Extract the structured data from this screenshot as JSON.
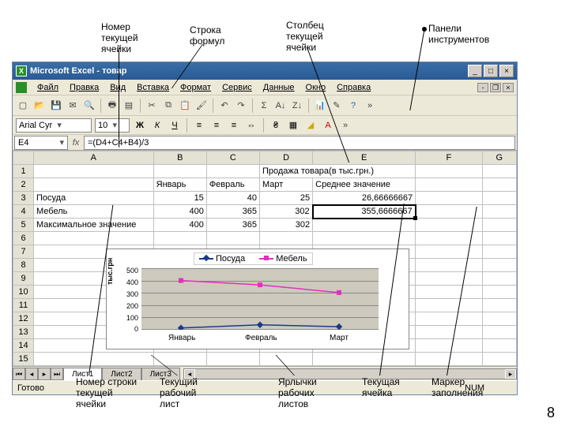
{
  "page_number": "8",
  "annotations": {
    "namebox": "Номер\nтекущей\nячейки",
    "formula": "Строка\nформул",
    "column": "Столбец\nтекущей\nячейки",
    "toolbars": "Панели\nинструментов",
    "rownum": "Номер строки\nтекущей\nячейки",
    "cursheet": "Текущий\nрабочий\nлист",
    "sheettabs": "Ярлычки\nрабочих\nлистов",
    "curcell": "Текущая\nячейка",
    "fillhandle": "Маркер\nзаполнения"
  },
  "title": "Microsoft Excel - товар",
  "menu": [
    "Файл",
    "Правка",
    "Вид",
    "Вставка",
    "Формат",
    "Сервис",
    "Данные",
    "Окно",
    "Справка"
  ],
  "font_name": "Arial Cyr",
  "font_size": "10",
  "name_box": "E4",
  "formula_text": "=(D4+C4+B4)/3",
  "col_headers": [
    "A",
    "B",
    "C",
    "D",
    "E",
    "F",
    "G"
  ],
  "rows": {
    "r1": {
      "D": "Продажа товара(в тыс.грн.)"
    },
    "r2": {
      "B": "Январь",
      "C": "Февраль",
      "D": "Март",
      "E": "Среднее значение"
    },
    "r3": {
      "A": "Посуда",
      "B": "15",
      "C": "40",
      "D": "25",
      "E": "26,66666667"
    },
    "r4": {
      "A": "Мебель",
      "B": "400",
      "C": "365",
      "D": "302",
      "E": "355,6666667"
    },
    "r5": {
      "A": "Максимальное значение",
      "B": "400",
      "C": "365",
      "D": "302"
    }
  },
  "chart_data": {
    "type": "line",
    "ylabel": "тыс.грн",
    "ylim": [
      0,
      500
    ],
    "yticks": [
      0,
      100,
      200,
      300,
      400,
      500
    ],
    "categories": [
      "Январь",
      "Февраль",
      "Март"
    ],
    "series": [
      {
        "name": "Посуда",
        "color": "#1a3a8a",
        "values": [
          15,
          40,
          25
        ]
      },
      {
        "name": "Мебель",
        "color": "#e030c0",
        "values": [
          400,
          365,
          302
        ]
      }
    ]
  },
  "sheets": [
    "Лист1",
    "Лист2",
    "Лист3"
  ],
  "status": {
    "ready": "Готово",
    "num": "NUM"
  }
}
